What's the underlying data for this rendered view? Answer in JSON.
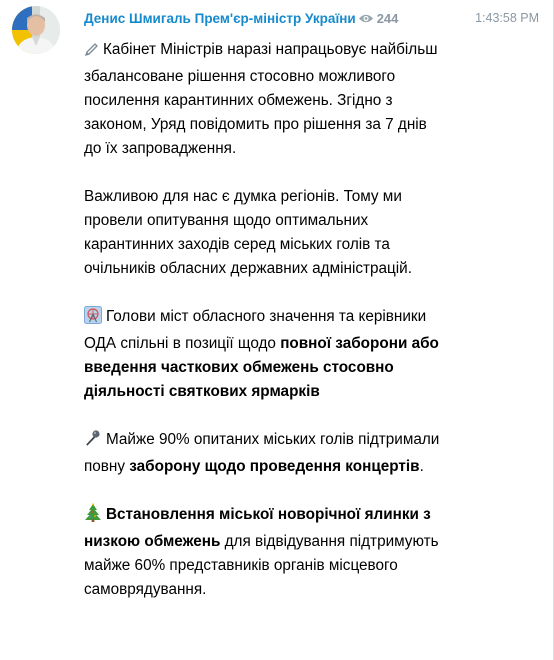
{
  "post": {
    "author": "Денис Шмигаль Прем'єр-міністр України",
    "views": "244",
    "time": "1:43:58 PM",
    "avatar_icon": "person-portrait-icon",
    "paragraphs": [
      {
        "icon": "pencil-icon",
        "text": "Кабінет Міністрів наразі напрацьовує найбільш збалансоване рішення стосовно можливого посилення карантинних обмежень. Згідно з законом, Уряд повідомить про рішення за 7 днів до їх запровадження."
      },
      {
        "text": "Важливою для нас є думка регіонів. Тому ми провели опитування щодо оптимальних карантинних заходів серед міських голів та очільників обласних державних адміністрацій."
      },
      {
        "icon": "ferris-wheel-icon",
        "text_before": "Голови міст обласного значення та керівники ОДА спільні в позиції щодо ",
        "bold": "повної заборони або введення часткових обмежень стосовно діяльності святкових ярмарків",
        "text_after": ""
      },
      {
        "icon": "microphone-icon",
        "text_before": "Майже 90% опитаних міських голів підтримали повну ",
        "bold": "заборону щодо проведення концертів",
        "text_after": "."
      },
      {
        "icon": "christmas-tree-icon",
        "text_before": "",
        "bold": "Встановлення міської новорічної ялинки з низкою обмежень",
        "text_after": " для відвідування підтримують майже 60% представників органів місцевого самоврядування."
      }
    ]
  }
}
